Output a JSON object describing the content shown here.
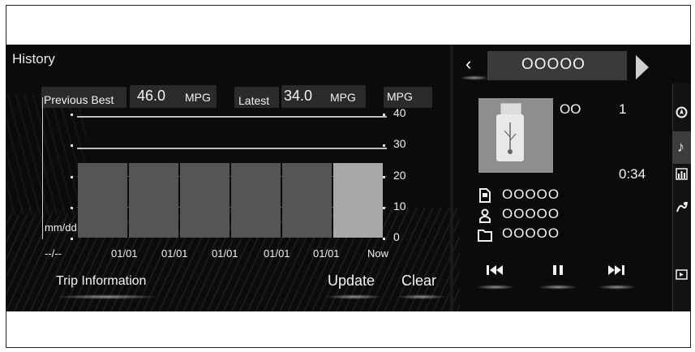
{
  "history": {
    "title": "History",
    "previous_best_label": "Previous Best",
    "previous_best_value": "46.0",
    "previous_best_unit": "MPG",
    "latest_label": "Latest",
    "latest_value": "34.0",
    "latest_unit": "MPG",
    "axis_unit": "MPG",
    "date_label": "mm/dd",
    "buttons": {
      "trip_information": "Trip Information",
      "update": "Update",
      "clear": "Clear"
    }
  },
  "chart_data": {
    "type": "bar",
    "categories": [
      "--/--",
      "01/01",
      "01/01",
      "01/01",
      "01/01",
      "01/01",
      "Now"
    ],
    "values": [
      24,
      24,
      24,
      24,
      24,
      24
    ],
    "bar_highlight_last": true,
    "yticks": [
      "40",
      "30",
      "20",
      "10",
      "0"
    ],
    "ylim": [
      0,
      40
    ],
    "reference_lines": [
      46.0,
      34.0
    ],
    "ylabel": "MPG",
    "colors": {
      "bar": "#555555",
      "bar_now": "#a8a8a8",
      "reference": "#bdbdbd"
    }
  },
  "media": {
    "source_title": "OOOOO",
    "track_code": "OO",
    "track_number": "1",
    "elapsed": "0:34",
    "song": "OOOOO",
    "artist": "OOOOO",
    "album": "OOOOO",
    "icons": {
      "prev_source": "chevron-left-icon",
      "next_source": "chevron-right-icon",
      "previous_track": "skip-back-icon",
      "pause": "pause-icon",
      "next_track": "skip-forward-icon"
    }
  },
  "side_menu": {
    "items": [
      "navigation-icon",
      "music-note-icon",
      "equalizer-icon",
      "route-icon",
      "screen-icon"
    ],
    "active": "music-note-icon"
  }
}
